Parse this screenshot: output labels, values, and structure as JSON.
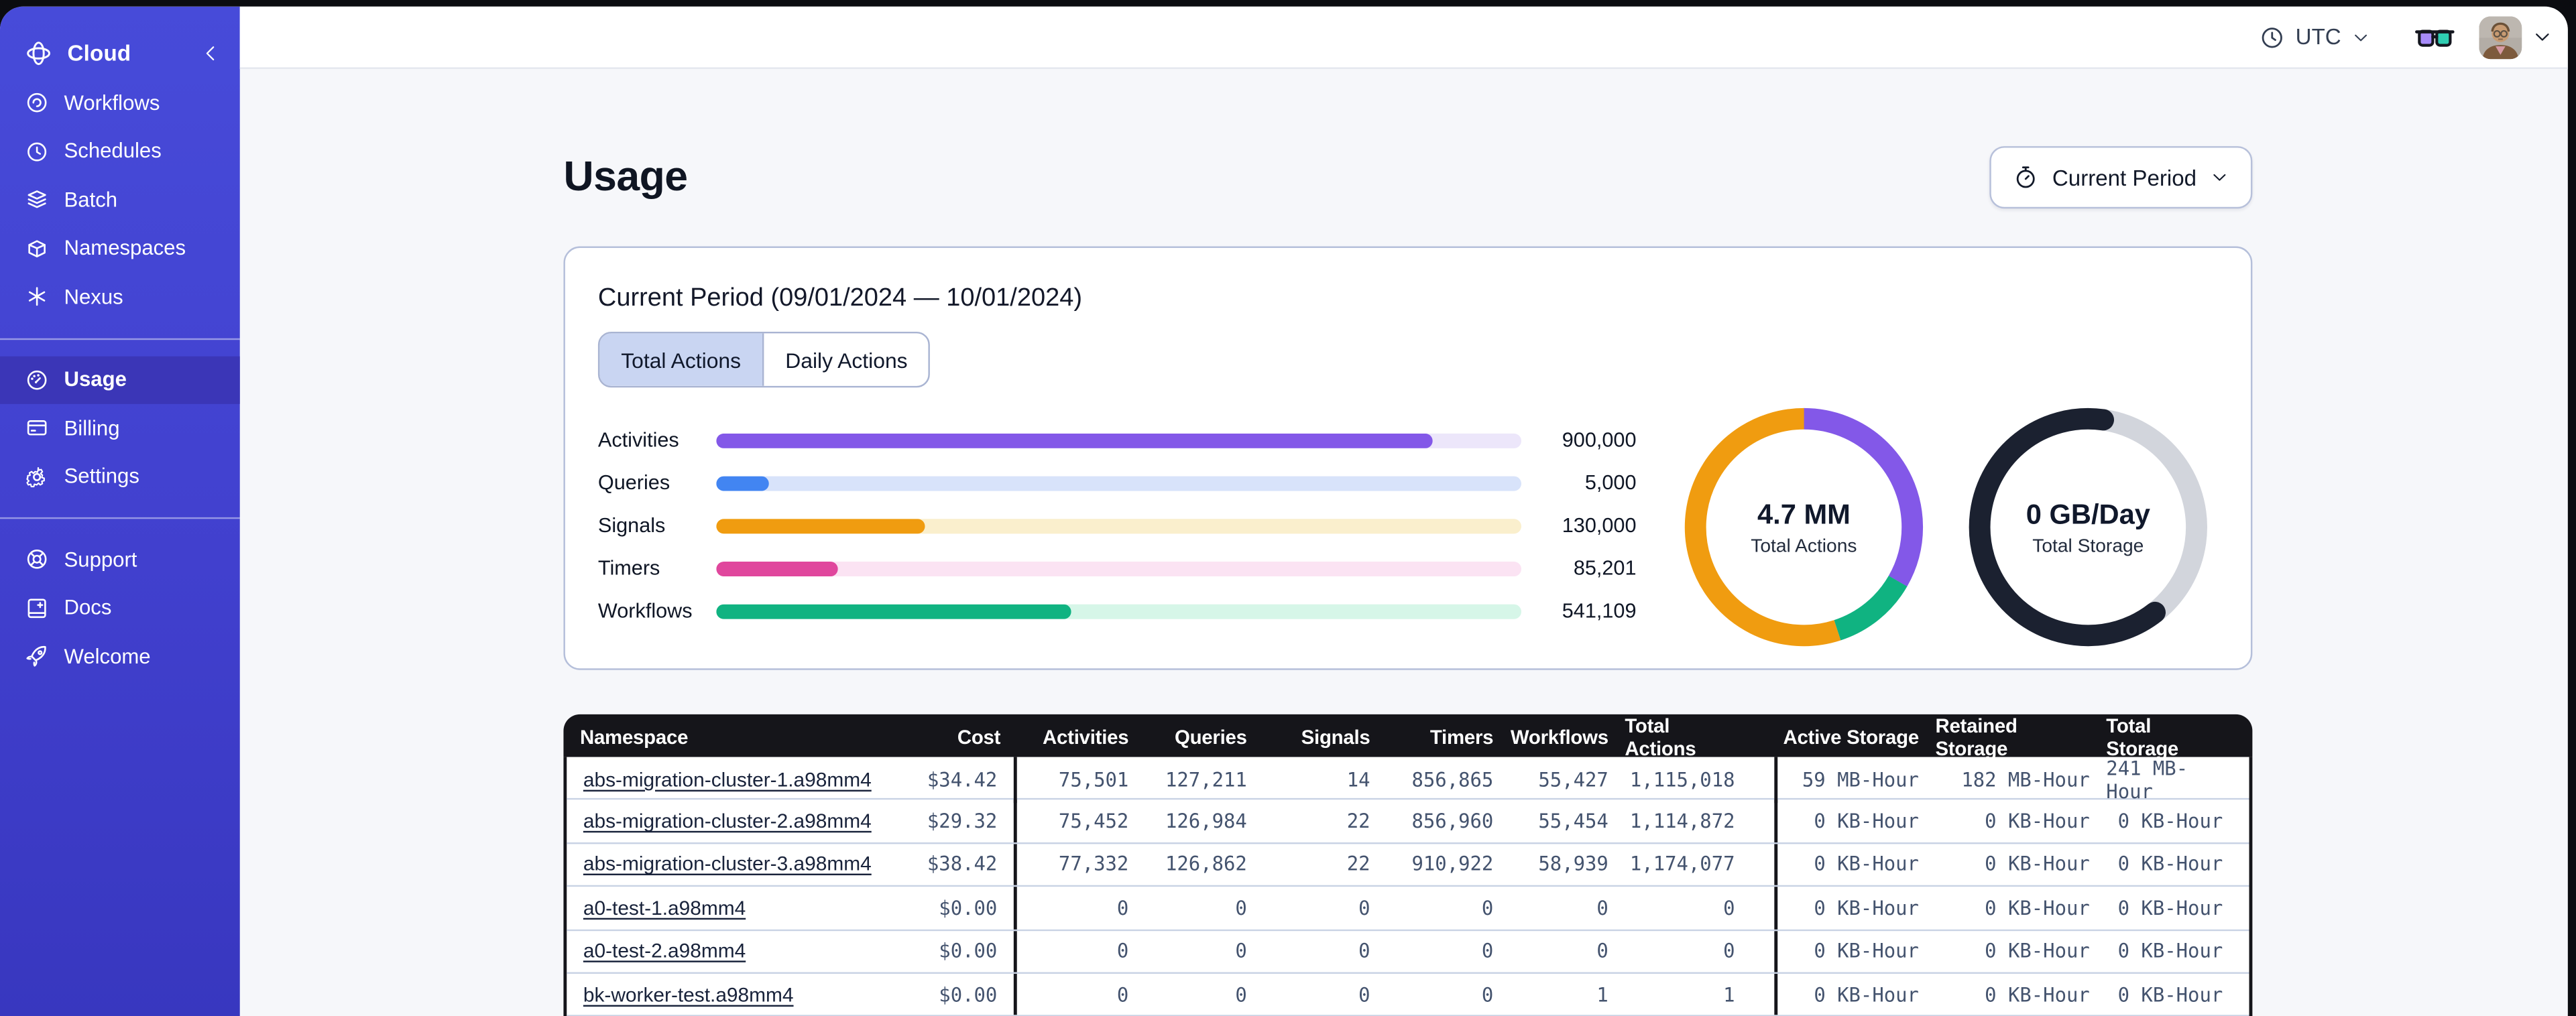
{
  "topbar": {
    "timezone": "UTC",
    "icons": [
      "clock-icon",
      "chevron-down-icon",
      "glasses-icon",
      "avatar",
      "chevron-down-icon"
    ]
  },
  "sidebar": {
    "brand": "Cloud",
    "brand_icon": "temporal-logo-icon",
    "collapse_icon": "chevron-left-icon",
    "groups": [
      {
        "items": [
          {
            "label": "Workflows",
            "icon": "workflows-icon",
            "active": false
          },
          {
            "label": "Schedules",
            "icon": "schedules-icon",
            "active": false
          },
          {
            "label": "Batch",
            "icon": "batch-icon",
            "active": false
          },
          {
            "label": "Namespaces",
            "icon": "namespaces-icon",
            "active": false
          },
          {
            "label": "Nexus",
            "icon": "nexus-icon",
            "active": false
          }
        ]
      },
      {
        "items": [
          {
            "label": "Usage",
            "icon": "usage-icon",
            "active": true
          },
          {
            "label": "Billing",
            "icon": "billing-icon",
            "active": false
          },
          {
            "label": "Settings",
            "icon": "settings-icon",
            "active": false
          }
        ]
      },
      {
        "items": [
          {
            "label": "Support",
            "icon": "support-icon",
            "active": false
          },
          {
            "label": "Docs",
            "icon": "docs-icon",
            "active": false
          },
          {
            "label": "Welcome",
            "icon": "welcome-icon",
            "active": false
          }
        ]
      }
    ]
  },
  "page": {
    "title": "Usage",
    "period_button_label": "Current Period",
    "period_button_icon": "stopwatch-icon"
  },
  "card": {
    "title": "Current Period (09/01/2024 — 10/01/2024)",
    "tabs": [
      {
        "label": "Total Actions",
        "active": true
      },
      {
        "label": "Daily Actions",
        "active": false
      }
    ]
  },
  "chart_data": [
    {
      "type": "bar",
      "orientation": "horizontal",
      "title": "Current Period (09/01/2024 — 10/01/2024)",
      "categories": [
        "Activities",
        "Queries",
        "Signals",
        "Timers",
        "Workflows"
      ],
      "values": [
        900000,
        5000,
        130000,
        85201,
        541109
      ],
      "value_labels": [
        "900,000",
        "5,000",
        "130,000",
        "85,201",
        "541,109"
      ],
      "fill_pct": [
        89,
        6.6,
        26,
        15.2,
        44
      ],
      "colors": [
        "#8358E8",
        "#4285F2",
        "#F09C10",
        "#E0479D",
        "#10B381"
      ],
      "track_colors": [
        "#ECE6FA",
        "#D8E3FA",
        "#FAEFCD",
        "#FBE3F3",
        "#D6F6E8"
      ],
      "grid": false,
      "legend": false
    },
    {
      "type": "pie",
      "subtype": "donut",
      "center_value": "4.7 MM",
      "center_label": "Total Actions",
      "start_angle_deg": 0,
      "segments": [
        {
          "name": "activities",
          "color": "#8358E8",
          "pct": 33.3,
          "cap": "butt"
        },
        {
          "name": "workflows",
          "color": "#10B381",
          "pct": 11.7,
          "cap": "butt"
        },
        {
          "name": "signals",
          "color": "#F09C10",
          "pct": 55.0,
          "cap": "butt"
        }
      ]
    },
    {
      "type": "pie",
      "subtype": "donut",
      "center_value": "0 GB/Day",
      "center_label": "Total Storage",
      "start_angle_deg": 8,
      "segments": [
        {
          "name": "used",
          "color": "#D2D5DC",
          "pct": 37.2,
          "cap": "butt"
        },
        {
          "name": "remaining",
          "color": "#1B2130",
          "pct": 62.8,
          "cap": "round"
        }
      ]
    }
  ],
  "table": {
    "columns": [
      "Namespace",
      "Cost",
      "Activities",
      "Queries",
      "Signals",
      "Timers",
      "Workflows",
      "Total Actions",
      "Active Storage",
      "Retained Storage",
      "Total Storage"
    ],
    "keys": [
      "namespace",
      "cost",
      "activities",
      "queries",
      "signals",
      "timers",
      "workflows",
      "total_actions",
      "active_storage",
      "retained_storage",
      "total_storage"
    ],
    "rows": [
      {
        "namespace": "abs-migration-cluster-1.a98mm4",
        "cost": "$34.42",
        "activities": "75,501",
        "queries": "127,211",
        "signals": "14",
        "timers": "856,865",
        "workflows": "55,427",
        "total_actions": "1,115,018",
        "active_storage": "59 MB-Hour",
        "retained_storage": "182 MB-Hour",
        "total_storage": "241 MB-Hour"
      },
      {
        "namespace": "abs-migration-cluster-2.a98mm4",
        "cost": "$29.32",
        "activities": "75,452",
        "queries": "126,984",
        "signals": "22",
        "timers": "856,960",
        "workflows": "55,454",
        "total_actions": "1,114,872",
        "active_storage": "0 KB-Hour",
        "retained_storage": "0 KB-Hour",
        "total_storage": "0 KB-Hour"
      },
      {
        "namespace": "abs-migration-cluster-3.a98mm4",
        "cost": "$38.42",
        "activities": "77,332",
        "queries": "126,862",
        "signals": "22",
        "timers": "910,922",
        "workflows": "58,939",
        "total_actions": "1,174,077",
        "active_storage": "0 KB-Hour",
        "retained_storage": "0 KB-Hour",
        "total_storage": "0 KB-Hour"
      },
      {
        "namespace": "a0-test-1.a98mm4",
        "cost": "$0.00",
        "activities": "0",
        "queries": "0",
        "signals": "0",
        "timers": "0",
        "workflows": "0",
        "total_actions": "0",
        "active_storage": "0 KB-Hour",
        "retained_storage": "0 KB-Hour",
        "total_storage": "0 KB-Hour"
      },
      {
        "namespace": "a0-test-2.a98mm4",
        "cost": "$0.00",
        "activities": "0",
        "queries": "0",
        "signals": "0",
        "timers": "0",
        "workflows": "0",
        "total_actions": "0",
        "active_storage": "0 KB-Hour",
        "retained_storage": "0 KB-Hour",
        "total_storage": "0 KB-Hour"
      },
      {
        "namespace": "bk-worker-test.a98mm4",
        "cost": "$0.00",
        "activities": "0",
        "queries": "0",
        "signals": "0",
        "timers": "0",
        "workflows": "1",
        "total_actions": "1",
        "active_storage": "0 KB-Hour",
        "retained_storage": "0 KB-Hour",
        "total_storage": "0 KB-Hour"
      }
    ]
  },
  "colors": {
    "sidebar_top": "#474BD9",
    "sidebar_bottom": "#3837BF",
    "sidebar_active": "#3B36B7",
    "content_bg": "#F6F7FA",
    "table_header_bg": "#15151A",
    "tab_active_bg": "#C9D5F2",
    "glasses_left_lens": "#A78BFA",
    "glasses_right_lens": "#2FCDB2"
  }
}
